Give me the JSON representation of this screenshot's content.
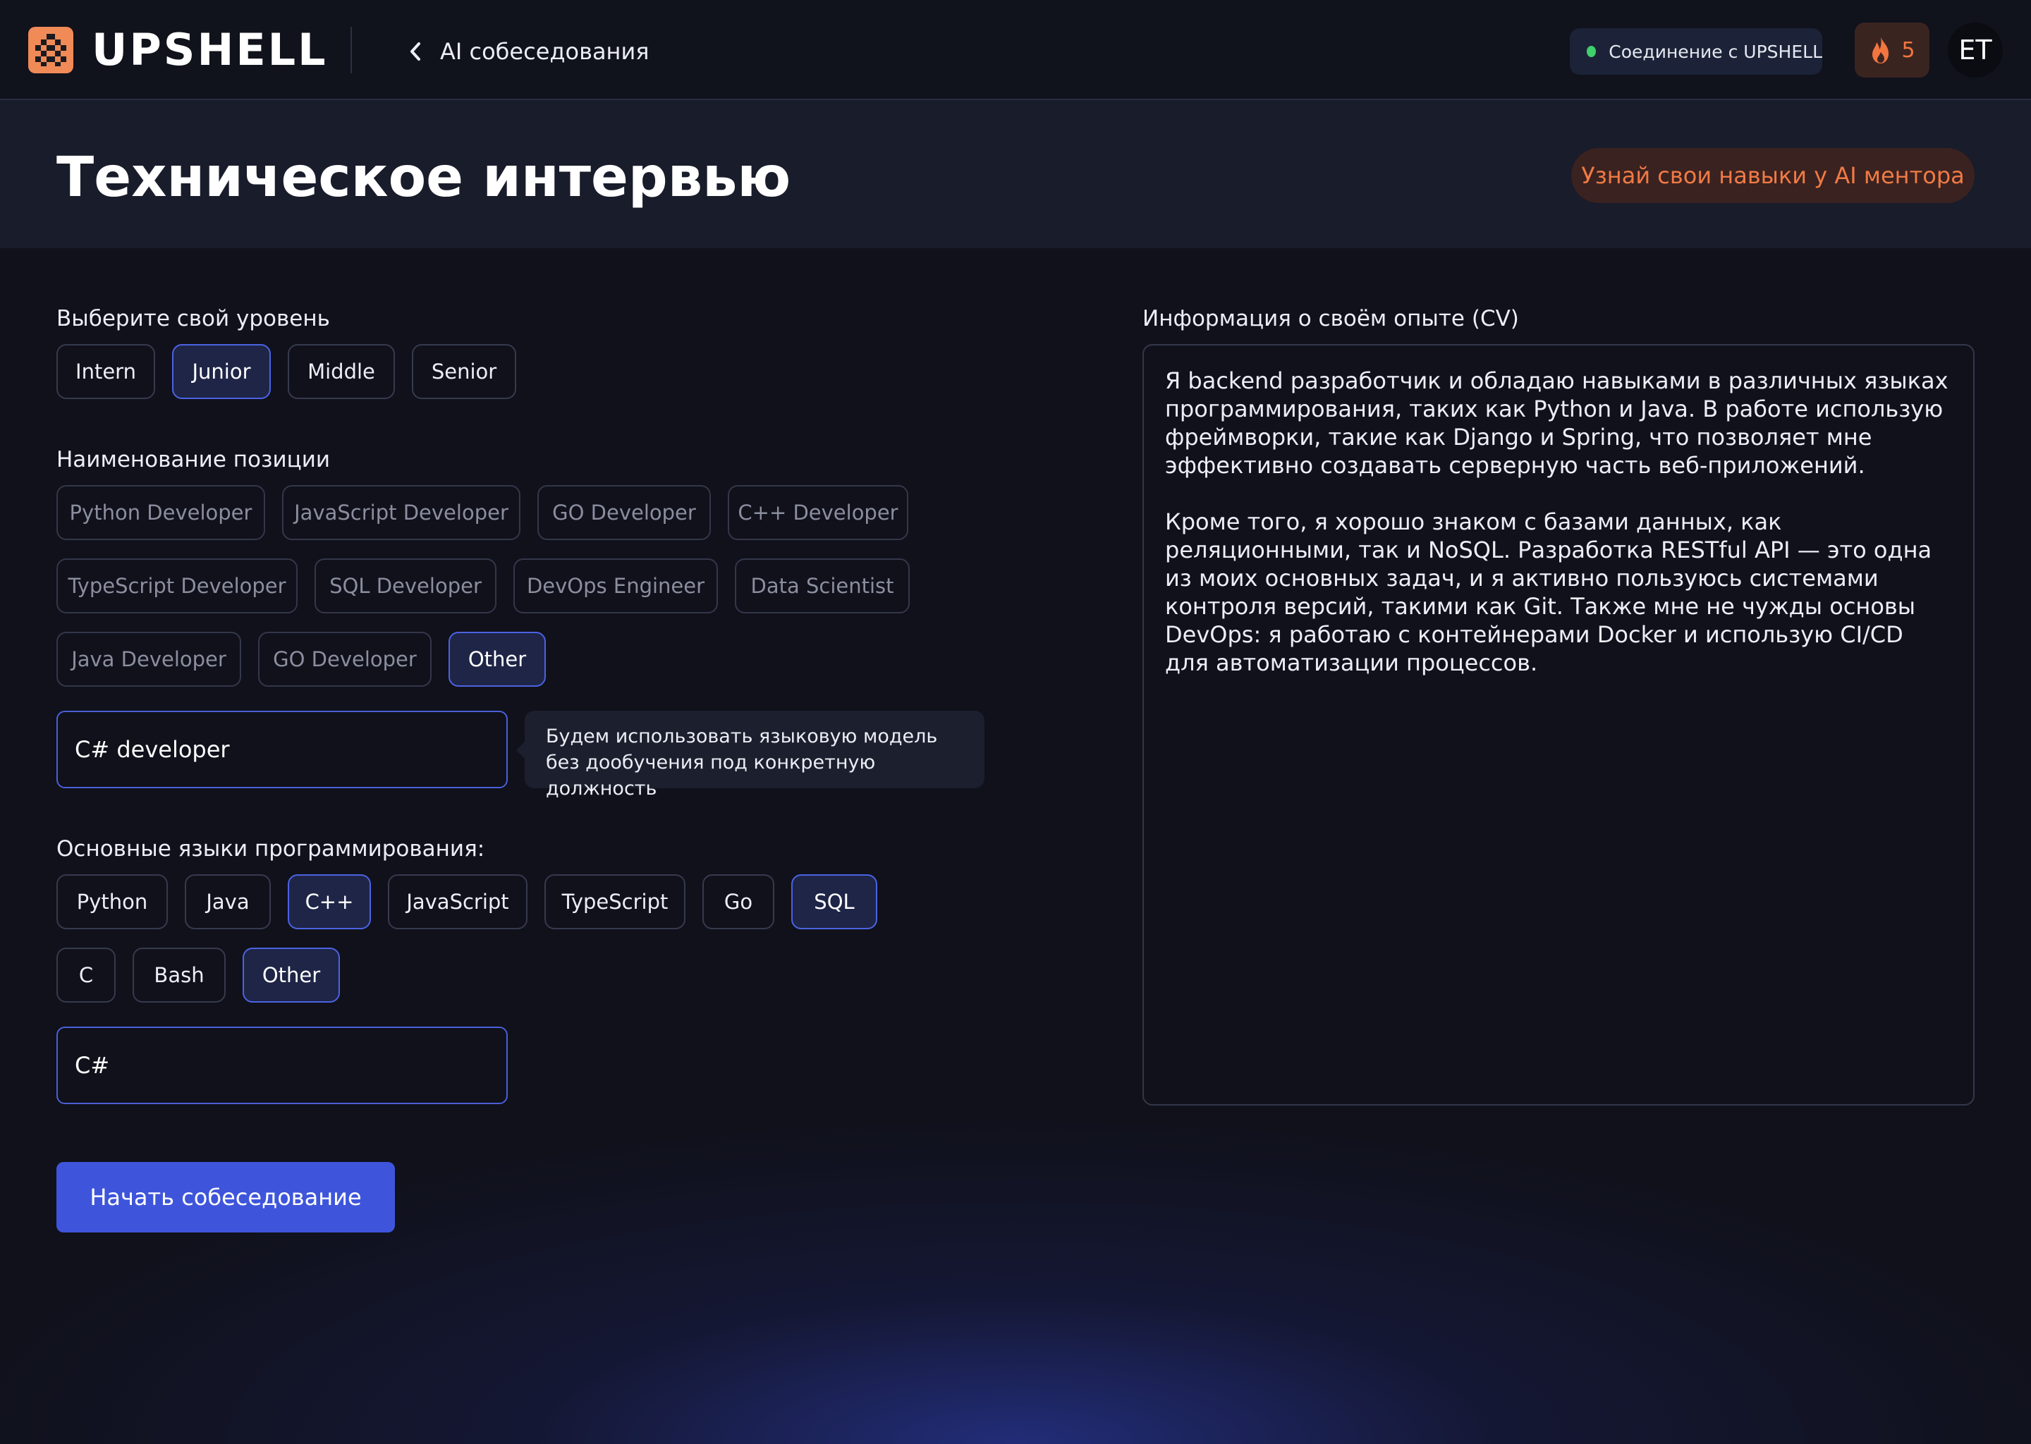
{
  "brand": {
    "name": "UPSHELL",
    "accent": "#f2763f"
  },
  "header": {
    "back_label": "AI собеседования",
    "connection_label": "Соединение с UPSHELL",
    "connection_color": "#3fd06b",
    "streak_count": "5",
    "avatar_initials": "ET"
  },
  "hero": {
    "title": "Техническое интервью",
    "mentor_button": "Узнай свои навыки у AI ментора"
  },
  "level": {
    "label": "Выберите свой уровень",
    "options": [
      "Intern",
      "Junior",
      "Middle",
      "Senior"
    ],
    "selected": "Junior"
  },
  "position": {
    "label": "Наименование позиции",
    "options": [
      "Python Developer",
      "JavaScript Developer",
      "GO Developer",
      "C++ Developer",
      "TypeScript Developer",
      "SQL Developer",
      "DevOps Engineer",
      "Data Scientist",
      "Java Developer",
      "GO Developer",
      "Other"
    ],
    "selected": "Other",
    "custom_value": "C# developer",
    "hint": "Будем использовать языковую модель без дообучения под конкретную должность"
  },
  "languages": {
    "label": "Основные языки программирования:",
    "options": [
      "Python",
      "Java",
      "C++",
      "JavaScript",
      "TypeScript",
      "Go",
      "SQL",
      "C",
      "Bash",
      "Other"
    ],
    "selected": [
      "C++",
      "SQL",
      "Other"
    ],
    "custom_value": "C#"
  },
  "cv": {
    "label": "Информация о своём опыте (CV)",
    "paragraphs": [
      "Я backend разработчик и обладаю навыками в различных языках программирования, таких как Python и Java. В работе использую фреймворки, такие как Django и Spring, что позволяет мне эффективно создавать серверную часть веб-приложений.",
      "Кроме того, я хорошо знаком с базами данных, как реляционными, так и NoSQL. Разработка RESTful API — это одна из моих основных задач, и я активно пользуюсь системами контроля версий, такими как Git. Также мне не чужды основы DevOps: я работаю с контейнерами Docker и использую CI/CD для автоматизации процессов."
    ]
  },
  "actions": {
    "start_button": "Начать собеседование"
  },
  "icons": {
    "back": "chevron-left-icon",
    "streak": "flame-icon",
    "logo": "upshell-logo-icon"
  },
  "colors": {
    "primary": "#3e55db",
    "selected_border": "#4c63e2",
    "background": "#10111b"
  }
}
